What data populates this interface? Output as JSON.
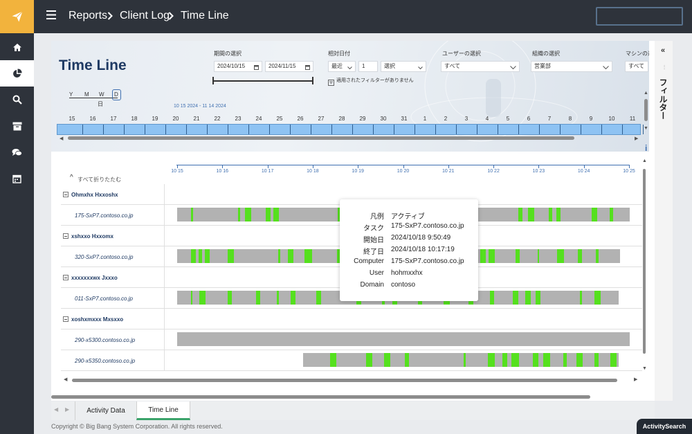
{
  "breadcrumb": [
    "Reports",
    "Client Log",
    "Time Line"
  ],
  "nav": {
    "items": [
      {
        "icon": "home-icon",
        "active": false
      },
      {
        "icon": "pie-chart-icon",
        "active": true
      },
      {
        "icon": "search-icon",
        "active": false
      },
      {
        "icon": "archive-icon",
        "active": false
      },
      {
        "icon": "chat-icon",
        "active": false
      },
      {
        "icon": "calendar-icon",
        "active": false
      }
    ]
  },
  "report": {
    "title": "Time Line",
    "filters": {
      "period": {
        "label": "期間の選択",
        "start": "2024/10/15",
        "end": "2024/11/15"
      },
      "relative": {
        "label": "相対日付",
        "unit": "最近",
        "count": "1",
        "select": "選択",
        "note": "適用されたフィルターがありません"
      },
      "user": {
        "label": "ユーザーの選択",
        "value": "すべて"
      },
      "org": {
        "label": "組織の選択",
        "value": "営業部"
      },
      "machine": {
        "label": "マシンの選",
        "value": "すべて"
      }
    },
    "granularity": {
      "options": [
        "Y",
        "M",
        "W",
        "D"
      ],
      "selected": "D",
      "caption": "日"
    },
    "range_text": "10 15 2024 - 11 14 2024",
    "days": [
      "15",
      "16",
      "17",
      "18",
      "19",
      "20",
      "21",
      "22",
      "23",
      "24",
      "25",
      "26",
      "27",
      "28",
      "29",
      "30",
      "31",
      "1",
      "2",
      "3",
      "4",
      "5",
      "6",
      "7",
      "8",
      "9",
      "10",
      "11"
    ],
    "collapse_all": "すべて折りたたむ",
    "axis_ticks": [
      "10 15",
      "10 16",
      "10 17",
      "10 18",
      "10 19",
      "10 20",
      "10 21",
      "10 22",
      "10 23",
      "10 24",
      "10 25"
    ],
    "rows": [
      {
        "type": "group",
        "label": "Ohmxhx Hxxoshx"
      },
      {
        "type": "machine",
        "label": "175-SxP7.contoso.co.jp"
      },
      {
        "type": "group",
        "label": "xshxxo Hxxomx"
      },
      {
        "type": "machine",
        "label": "320-SxP7.contoso.co.jp"
      },
      {
        "type": "group",
        "label": "xxxxxxxwx Jxxxo"
      },
      {
        "type": "machine",
        "label": "011-SxP7.contoso.co.jp"
      },
      {
        "type": "group",
        "label": "xoshxmxxx Mxsxxo"
      },
      {
        "type": "machine",
        "label": "290-x5300.contoso.co.jp"
      },
      {
        "type": "machine",
        "label": "290-x5350.contoso.co.jp"
      }
    ]
  },
  "tooltip": {
    "rows": [
      {
        "key": "凡例",
        "value": "アクティブ"
      },
      {
        "key": "タスク",
        "value": "175-SxP7.contoso.co.jp"
      },
      {
        "key": "開始日",
        "value": "2024/10/18 9:50:49"
      },
      {
        "key": "終了日",
        "value": "2024/10/18 10:17:19"
      },
      {
        "key": "Computer",
        "value": "175-SxP7.contoso.co.jp"
      },
      {
        "key": "User",
        "value": "hohmxxhx"
      },
      {
        "key": "Domain",
        "value": "contoso"
      }
    ]
  },
  "filter_panel": {
    "title": "フィルター"
  },
  "tabs": {
    "items": [
      "Activity Data",
      "Time Line"
    ],
    "active": "Time Line"
  },
  "footer": {
    "copyright": "Copyright © Big Bang System Corporation. All rights reserved.",
    "activity_button": "ActivitySearch"
  },
  "colors": {
    "nav_bg": "#2e333b",
    "logo_bg": "#f2b33d",
    "title": "#1f3a63",
    "strip": "#8ec3f3",
    "active_seg": "#55e01e",
    "idle_bar": "#b2b2b2"
  }
}
